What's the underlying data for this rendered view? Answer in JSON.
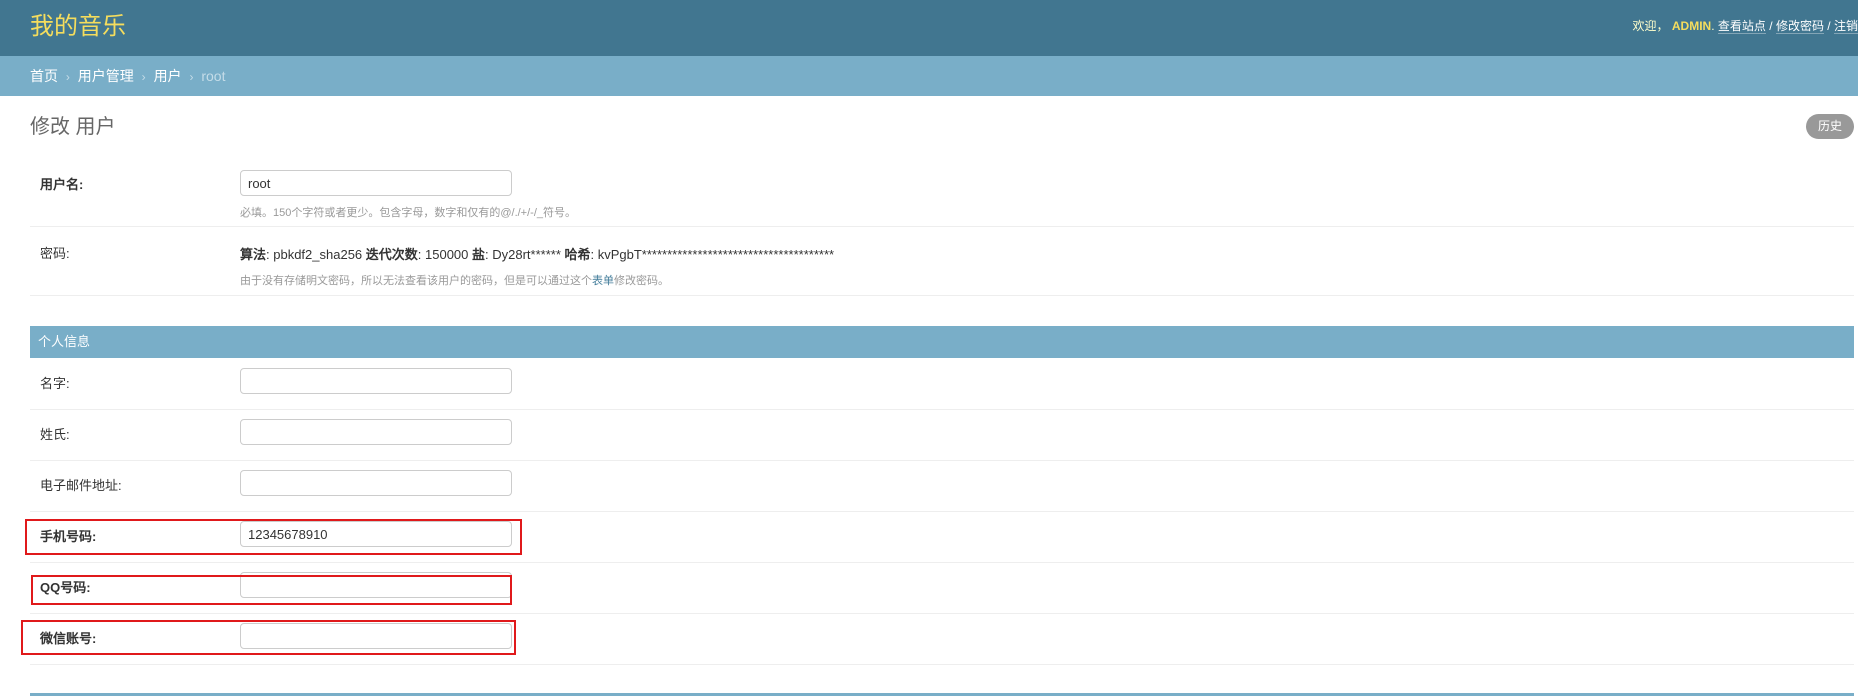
{
  "header": {
    "brand": "我的音乐",
    "welcome": "欢迎，",
    "username": "ADMIN",
    "period": ".",
    "view_site": "查看站点",
    "change_password": "修改密码",
    "logout": "注销",
    "separator": "/"
  },
  "breadcrumbs": {
    "items": [
      "首页",
      "用户管理",
      "用户"
    ],
    "current": "root",
    "arrow": "›"
  },
  "page": {
    "title": "修改 用户",
    "history": "历史"
  },
  "fields": {
    "username": {
      "label": "用户名:",
      "value": "root",
      "help": "必填。150个字符或者更少。包含字母，数字和仅有的@/./+/-/_符号。"
    },
    "password": {
      "label": "密码:",
      "algorithm_label": "算法",
      "algorithm_value": ": pbkdf2_sha256 ",
      "iterations_label": "迭代次数",
      "iterations_value": ": 150000 ",
      "salt_label": "盐",
      "salt_value": ": Dy28rt****** ",
      "hash_label": "哈希",
      "hash_value": ": kvPgbT**************************************",
      "help_before": "由于没有存储明文密码，所以无法查看该用户的密码，但是可以通过这个",
      "help_link": "表单",
      "help_after": "修改密码。"
    }
  },
  "personal_section": {
    "title": "个人信息",
    "first_name": {
      "label": "名字:",
      "value": ""
    },
    "last_name": {
      "label": "姓氏:",
      "value": ""
    },
    "email": {
      "label": "电子邮件地址:",
      "value": ""
    },
    "phone": {
      "label": "手机号码:",
      "value": "12345678910"
    },
    "qq": {
      "label": "QQ号码:",
      "value": ""
    },
    "wechat": {
      "label": "微信账号:",
      "value": ""
    }
  },
  "colors": {
    "header_bg": "#417690",
    "breadcrumb_bg": "#79aec8",
    "brand": "#f5dd5d",
    "highlight": "#e0191b"
  }
}
